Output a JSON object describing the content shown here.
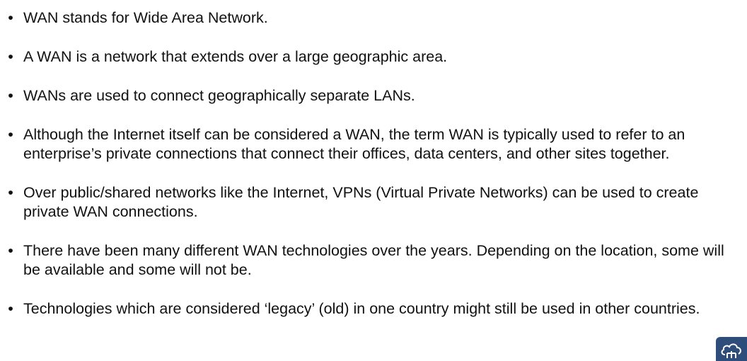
{
  "bullets": [
    {
      "text": "WAN stands for Wide Area Network."
    },
    {
      "text": "A WAN is a network that extends over a large geographic area."
    },
    {
      "text": "WANs are used to connect geographically separate LANs."
    },
    {
      "text": "Although the Internet itself can be considered a WAN, the term WAN is typically used to refer to an enterprise’s private connections that connect their offices, data centers, and other sites together."
    },
    {
      "text": "Over public/shared networks like the Internet, VPNs (Virtual Private Networks) can be used to create private WAN connections."
    },
    {
      "text": "There have been many different WAN technologies over the years.  Depending on the location, some will be available and some will not be."
    },
    {
      "text": "Technologies which are considered ‘legacy’ (old) in one country might still be used in other countries."
    }
  ],
  "bullet_symbol": "•",
  "logo": {
    "icon": "cloud-network-icon",
    "color": "#2f4d7a"
  }
}
